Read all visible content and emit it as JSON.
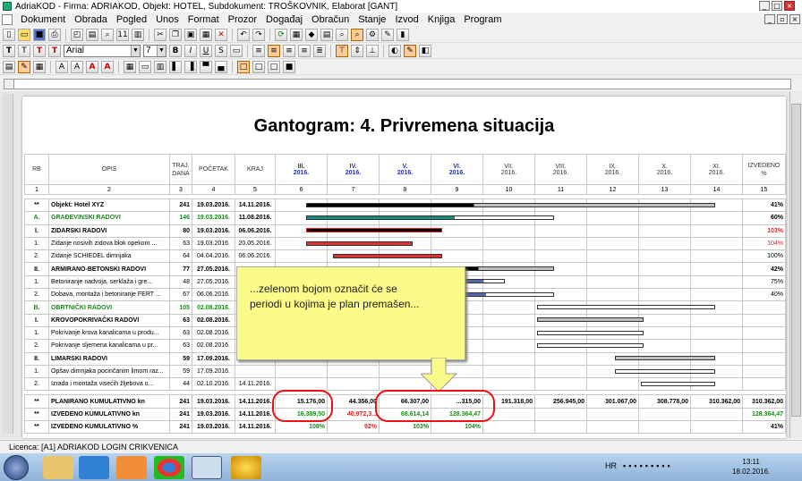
{
  "window": {
    "title": "AdriaKOD - Firma: ADRIAKOD,  Objekt: HOTEL,  Subdokument: TROŠKOVNIK,  Elaborat [GANT]"
  },
  "menu": [
    "Dokument",
    "Obrada",
    "Pogled",
    "Unos",
    "Format",
    "Prozor",
    "Događaj",
    "Obračun",
    "Stanje",
    "Izvod",
    "Knjiga",
    "Program"
  ],
  "toolbar": {
    "font": "Arial",
    "size": "7"
  },
  "gantt": {
    "title": "Gantogram: 4. Privremena situacija",
    "headers": {
      "rb": "RB",
      "opis": "OPIS",
      "trajanje": "TRAJ. DANA",
      "pocetak": "POČETAK",
      "kraj": "KRAJ",
      "months": [
        {
          "m": "III.",
          "y": "2016."
        },
        {
          "m": "IV.",
          "y": "2016."
        },
        {
          "m": "V.",
          "y": "2016."
        },
        {
          "m": "VI.",
          "y": "2016."
        },
        {
          "m": "VII.",
          "y": "2016."
        },
        {
          "m": "VIII.",
          "y": "2016."
        },
        {
          "m": "IX.",
          "y": "2016."
        },
        {
          "m": "X.",
          "y": "2016."
        },
        {
          "m": "XI.",
          "y": "2016."
        }
      ],
      "izvedeno": "IZVEDENO %"
    },
    "col_numbers": [
      "1",
      "2",
      "3",
      "4",
      "5",
      "6",
      "7",
      "8",
      "9",
      "10",
      "11",
      "12",
      "13",
      "14",
      "15"
    ],
    "rows": [
      {
        "rb": "**",
        "opis": "Objekt: Hotel XYZ",
        "traj": "241",
        "poc": "19.03.2016.",
        "kraj": "14.11.2016.",
        "pct": "41%",
        "style": "b"
      },
      {
        "rb": "A.",
        "opis": "GRAĐEVINSKI RADOVI",
        "traj": "146",
        "poc": "19.03.2016.",
        "kraj": "11.08.2016.",
        "pct": "60%",
        "style": "bg"
      },
      {
        "rb": "I.",
        "opis": "ZIDARSKI RADOVI",
        "traj": "80",
        "poc": "19.03.2016.",
        "kraj": "06.06.2016.",
        "pct": "103%",
        "style": "b"
      },
      {
        "rb": "1.",
        "opis": "Zidanje nosivih zidova blok opekom ...",
        "traj": "63",
        "poc": "19.03.2016.",
        "kraj": "20.05.2016.",
        "pct": "104%",
        "style": ""
      },
      {
        "rb": "2.",
        "opis": "Zidanje SCHIEDEL dimnjaka",
        "traj": "64",
        "poc": "04.04.2016.",
        "kraj": "06.06.2016.",
        "pct": "100%",
        "style": ""
      },
      {
        "rb": "II.",
        "opis": "ARMIRANO-BETONSKI RADOVI",
        "traj": "77",
        "poc": "27.05.2016.",
        "kraj": "11.08.2016.",
        "pct": "42%",
        "style": "b"
      },
      {
        "rb": "1.",
        "opis": "Betoniranje nadvoja, serklaža i gre...",
        "traj": "48",
        "poc": "27.05.2016.",
        "kraj": "",
        "pct": "75%",
        "style": ""
      },
      {
        "rb": "2.",
        "opis": "Dobava, montaža i betoniranje FERT ...",
        "traj": "67",
        "poc": "06.06.2016.",
        "kraj": "",
        "pct": "40%",
        "style": ""
      },
      {
        "rb": "B.",
        "opis": "OBRTNIČKI RADOVI",
        "traj": "105",
        "poc": "02.08.2016.",
        "kraj": "",
        "pct": "",
        "style": "bg"
      },
      {
        "rb": "I.",
        "opis": "KROVOPOKRIVAČKI RADOVI",
        "traj": "63",
        "poc": "02.08.2016.",
        "kraj": "",
        "pct": "",
        "style": "b"
      },
      {
        "rb": "1.",
        "opis": "Pokrivanje krova kanalicama u produ...",
        "traj": "63",
        "poc": "02.08.2016.",
        "kraj": "",
        "pct": "",
        "style": ""
      },
      {
        "rb": "2.",
        "opis": "Pokrivanje sljemena kanalicama u pr...",
        "traj": "63",
        "poc": "02.08.2016.",
        "kraj": "",
        "pct": "",
        "style": ""
      },
      {
        "rb": "II.",
        "opis": "LIMARSKI RADOVI",
        "traj": "59",
        "poc": "17.09.2016.",
        "kraj": "",
        "pct": "",
        "style": "b"
      },
      {
        "rb": "1.",
        "opis": "Opšav dimnjaka pocinčanim limom raz...",
        "traj": "59",
        "poc": "17.09.2016.",
        "kraj": "",
        "pct": "",
        "style": ""
      },
      {
        "rb": "2.",
        "opis": "Izrada i montaža visećih žljebova o...",
        "traj": "44",
        "poc": "02.10.2016.",
        "kraj": "14.11.2016.",
        "pct": "",
        "style": ""
      }
    ],
    "plan": {
      "rb": "**",
      "opis": "PLANIRANO KUMULATIVNO kn",
      "traj": "241",
      "poc": "19.03.2016.",
      "kraj": "14.11.2016.",
      "vals": [
        "15.176,00",
        "44.356,00",
        "66.307,00",
        "...315,00",
        "191.318,00",
        "256.945,00",
        "301.067,00",
        "308.778,00",
        "310.362,00"
      ],
      "pct": "310.362,00"
    },
    "izv": {
      "rb": "**",
      "opis": "IZVEDENO KUMULATIVNO kn",
      "traj": "241",
      "poc": "19.03.2016.",
      "kraj": "14.11.2016.",
      "vals": [
        "16.389,50",
        "40.972,3...",
        "68.614,14",
        "128.364,47"
      ],
      "pct": "128.364,47"
    },
    "izvpct": {
      "rb": "**",
      "opis": "IZVEDENO KUMULATIVNO %",
      "traj": "241",
      "poc": "19.03.2016.",
      "kraj": "14.11.2016.",
      "vals": [
        "108%",
        "92%",
        "103%",
        "104%"
      ],
      "pct": "41%"
    }
  },
  "callout": {
    "line1": "...zelenom bojom označit će se",
    "line2": "periodi u kojima je plan premašen..."
  },
  "status": {
    "licence": "Licenca: [A1] ADRIAKOD LOGIN CRIKVENICA"
  },
  "taskbar": {
    "lang": "HR",
    "time": "13:11",
    "date": "18.02.2016."
  }
}
